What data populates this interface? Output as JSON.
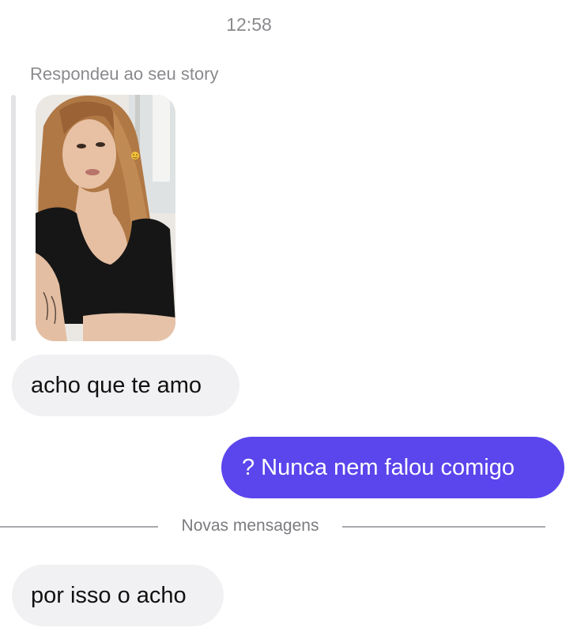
{
  "thread": {
    "timestamp": "12:58",
    "reply_note": "Respondeu ao seu story",
    "story_thumbnail": {
      "description_icon": "story-photo",
      "emoji": "smiling-face"
    },
    "messages": [
      {
        "id": "msg1",
        "direction": "incoming",
        "text": "acho que te amo"
      },
      {
        "id": "msg2",
        "direction": "outgoing",
        "text": "? Nunca nem falou comigo"
      },
      {
        "id": "msg3",
        "direction": "incoming",
        "text": "por isso o acho"
      }
    ],
    "new_messages_divider": "Novas mensagens"
  },
  "colors": {
    "outgoing_bubble": "#5b45ec",
    "incoming_bubble": "#f1f1f3",
    "meta_text": "#8a8a8e"
  }
}
